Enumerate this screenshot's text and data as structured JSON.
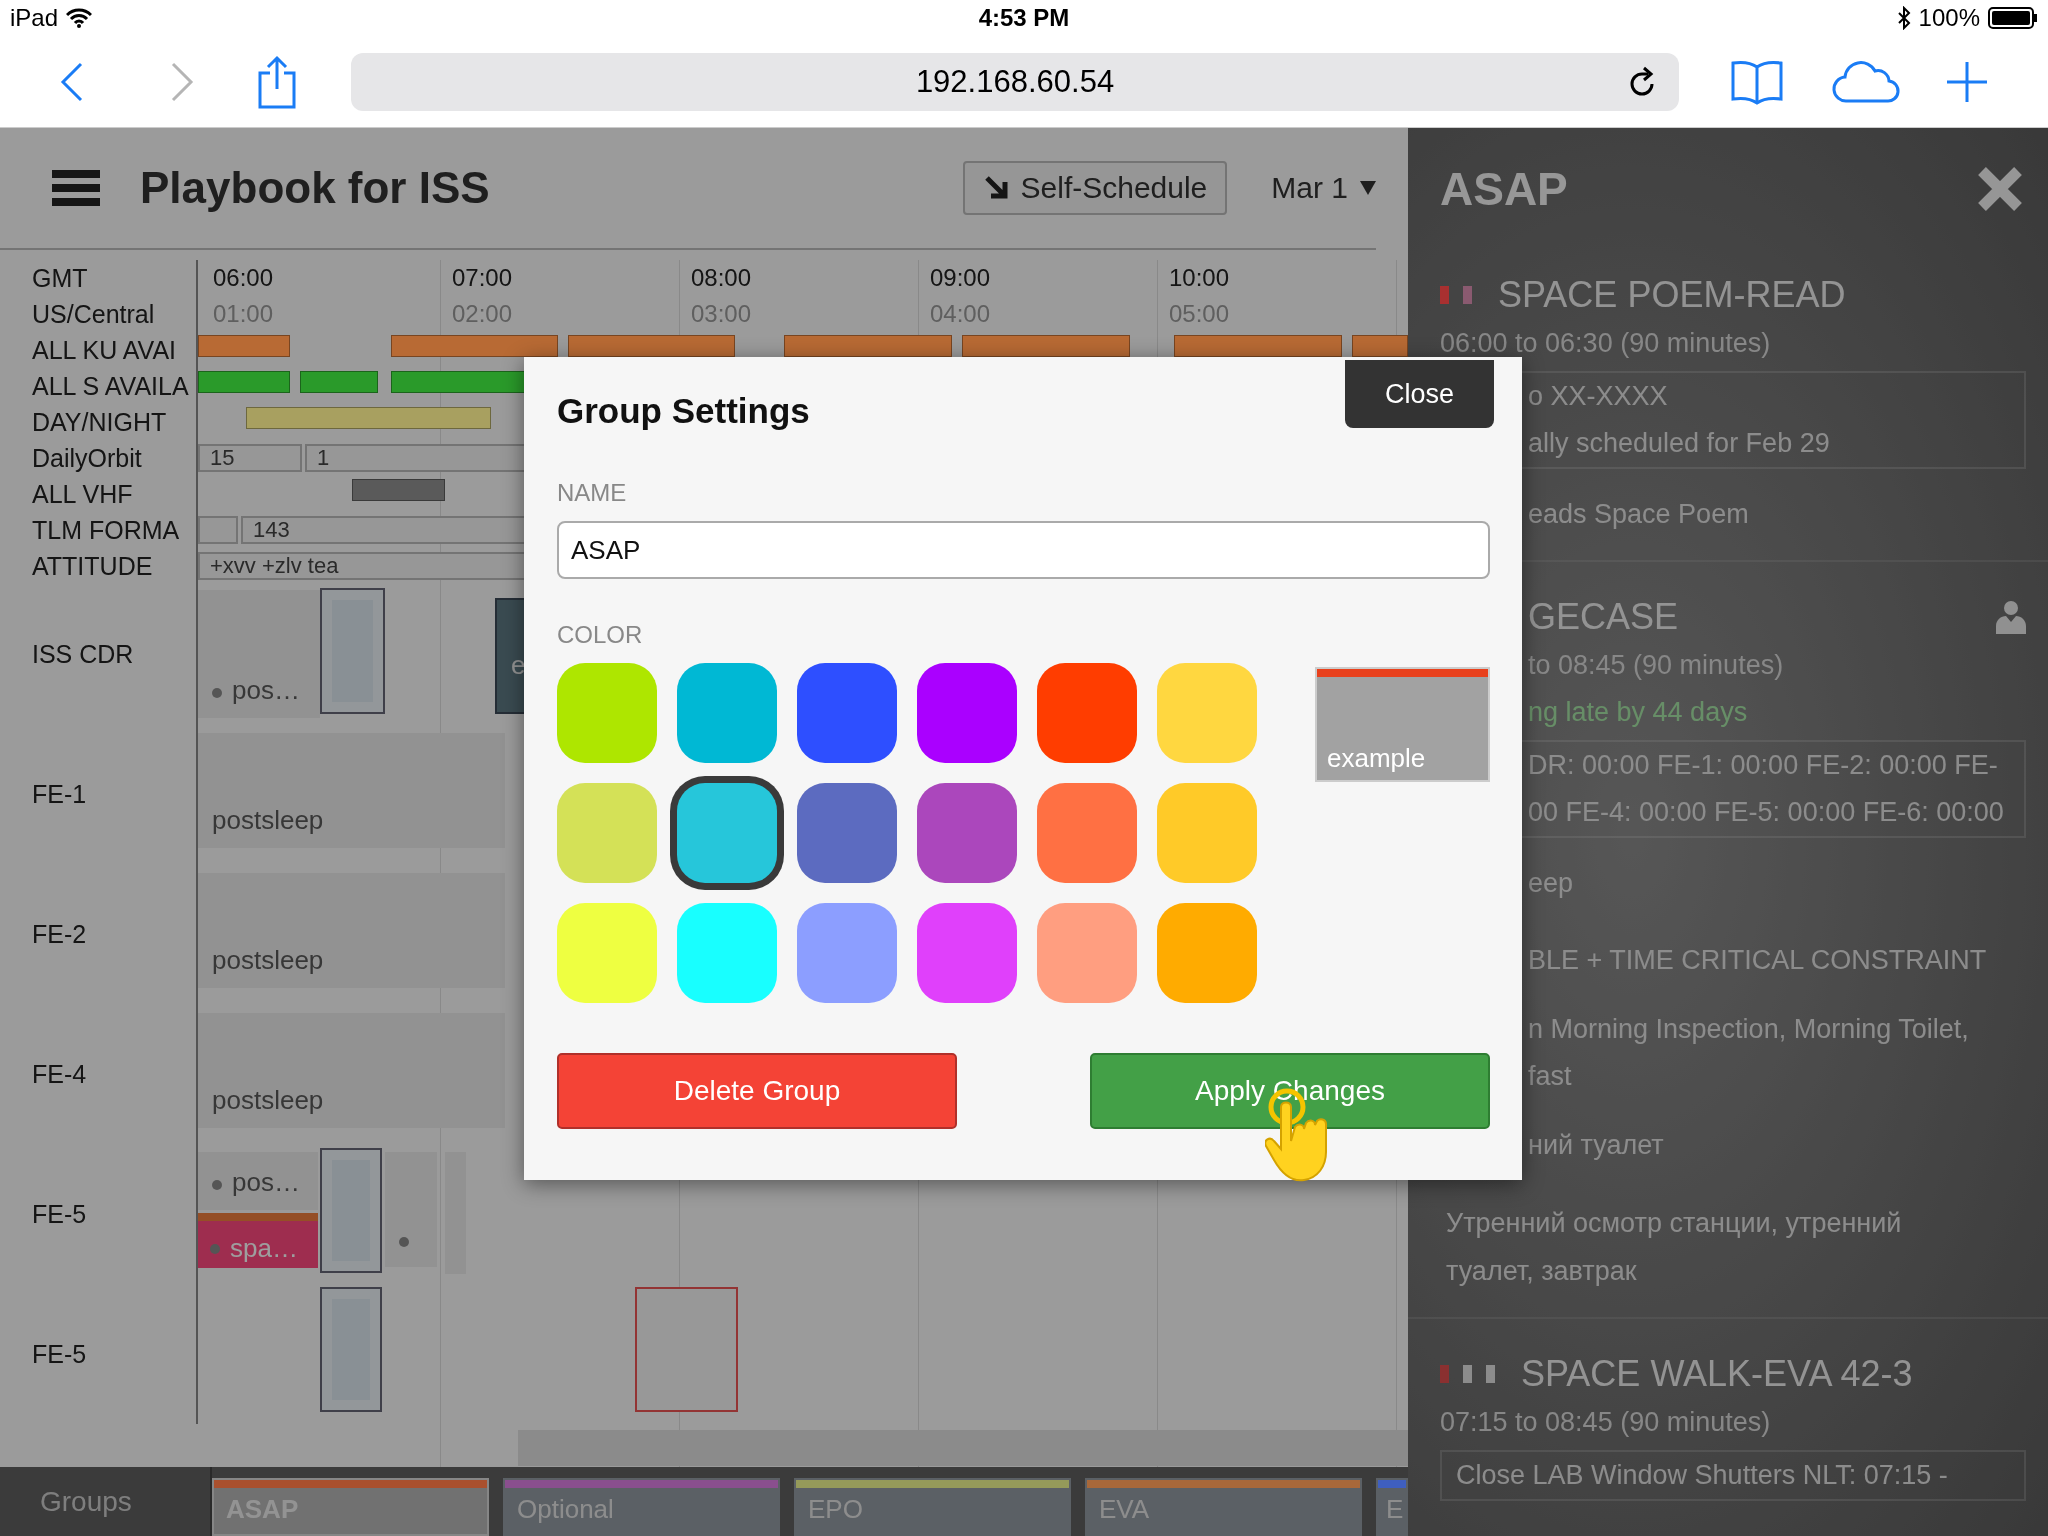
{
  "status_bar": {
    "device": "iPad",
    "time": "4:53 PM",
    "battery": "100%"
  },
  "browser": {
    "back": {
      "disabled": false
    },
    "forward": {
      "disabled": true
    },
    "url": "192.168.60.54"
  },
  "app_header": {
    "title": "Playbook for ISS",
    "self_schedule": "Self-Schedule",
    "date": "Mar 1"
  },
  "timeline": {
    "zones": [
      "GMT",
      "US/Central"
    ],
    "hours": [
      {
        "gmt": "06:00",
        "local": "01:00"
      },
      {
        "gmt": "07:00",
        "local": "02:00"
      },
      {
        "gmt": "08:00",
        "local": "03:00"
      },
      {
        "gmt": "09:00",
        "local": "04:00"
      },
      {
        "gmt": "10:00",
        "local": "05:00"
      }
    ],
    "rows": [
      {
        "label": "ALL KU AVAI",
        "kind": "band",
        "color": "#b86a34"
      },
      {
        "label": "ALL S AVAILA",
        "kind": "band",
        "color": "#2a9a2a"
      },
      {
        "label": "DAY/NIGHT",
        "kind": "band",
        "color": "#a8a060"
      },
      {
        "label": "DailyOrbit",
        "kind": "labels",
        "segments": [
          "15",
          "1"
        ]
      },
      {
        "label": "ALL VHF",
        "kind": "band",
        "color": "#5a5a5a"
      },
      {
        "label": "TLM FORMA",
        "kind": "labels",
        "segments": [
          "143"
        ]
      },
      {
        "label": "ATTITUDE",
        "kind": "labels",
        "segments": [
          "+xvv +zlv tea"
        ]
      },
      {
        "label": "ISS CDR",
        "kind": "crew",
        "activities": [
          "pos…",
          "e"
        ]
      },
      {
        "label": "FE-1",
        "kind": "crew",
        "activities": [
          "postsleep"
        ]
      },
      {
        "label": "FE-2",
        "kind": "crew",
        "activities": [
          "postsleep"
        ]
      },
      {
        "label": "FE-4",
        "kind": "crew",
        "activities": [
          "postsleep"
        ]
      },
      {
        "label": "FE-5",
        "kind": "crew",
        "activities": [
          "pos…",
          "spa…"
        ]
      },
      {
        "label": "FE-5",
        "kind": "crew"
      }
    ]
  },
  "groups": {
    "label": "Groups",
    "tabs": [
      {
        "label": "ASAP",
        "color": "#a9502e",
        "selected": true
      },
      {
        "label": "Optional",
        "color": "#8a4f8e",
        "selected": false
      },
      {
        "label": "EPO",
        "color": "#959a5a",
        "selected": false
      },
      {
        "label": "EVA",
        "color": "#a8683a",
        "selected": false
      },
      {
        "label": "E",
        "color": "#3f5fbf",
        "selected": false
      }
    ]
  },
  "panel": {
    "title": "ASAP",
    "activities": [
      {
        "title": "SPACE POEM-READ",
        "markers": [
          {
            "color": "#a83030"
          },
          {
            "color": "#8a5a70"
          }
        ],
        "lines": [
          {
            "kind": "time",
            "text": "06:00 to 06:30 (90 minutes)"
          },
          {
            "kind": "box",
            "lines": [
              "o XX-XXXX",
              "ally scheduled for Feb 29"
            ]
          },
          {
            "kind": "note",
            "lines": [
              "eads Space Poem"
            ]
          }
        ]
      },
      {
        "title": "GECASE",
        "person_icon": true,
        "lines": [
          {
            "kind": "time",
            "text": "to 08:45 (90 minutes)"
          },
          {
            "kind": "late",
            "text": "ng late by 44 days"
          },
          {
            "kind": "box",
            "lines": [
              "DR: 00:00 FE-1: 00:00 FE-2: 00:00 FE-",
              "00 FE-4: 00:00 FE-5: 00:00 FE-6: 00:00"
            ]
          },
          {
            "kind": "note",
            "lines": [
              "eep"
            ]
          },
          {
            "kind": "constraint",
            "text": "BLE + TIME CRITICAL CONSTRAINT"
          },
          {
            "kind": "lines",
            "lines": [
              "n Morning Inspection, Morning Toilet,",
              "fast"
            ]
          },
          {
            "kind": "note",
            "lines": [
              "ний туалет"
            ]
          },
          {
            "kind": "paragraph",
            "text": "Утренний осмотр станции, утренний туалет, завтрак"
          }
        ]
      },
      {
        "title": "SPACE WALK-EVA 42-3",
        "markers": [
          {
            "color": "#8a3030"
          },
          {
            "color": "#8c8c8c"
          },
          {
            "color": "#8c8c8c"
          }
        ],
        "lines": [
          {
            "kind": "time",
            "text": "07:15 to 08:45 (90 minutes)"
          },
          {
            "kind": "box",
            "lines": [
              "Close LAB Window Shutters NLT: 07:15 -"
            ]
          }
        ]
      }
    ]
  },
  "modal": {
    "title": "Group Settings",
    "close": "Close",
    "name_label": "NAME",
    "name_value": "ASAP",
    "color_label": "COLOR",
    "swatches": [
      {
        "color": "#aee600",
        "selected": false
      },
      {
        "color": "#00b8d4",
        "selected": false
      },
      {
        "color": "#2e4fff",
        "selected": false
      },
      {
        "color": "#aa00ff",
        "selected": false
      },
      {
        "color": "#ff3d00",
        "selected": false
      },
      {
        "color": "#ffd740",
        "selected": false
      },
      {
        "color": "#d4e157",
        "selected": false
      },
      {
        "color": "#26c6da",
        "selected": true
      },
      {
        "color": "#5c6bc0",
        "selected": false
      },
      {
        "color": "#ab47bc",
        "selected": false
      },
      {
        "color": "#ff7043",
        "selected": false
      },
      {
        "color": "#ffca28",
        "selected": false
      },
      {
        "color": "#eeff41",
        "selected": false
      },
      {
        "color": "#18ffff",
        "selected": false
      },
      {
        "color": "#8c9eff",
        "selected": false
      },
      {
        "color": "#e040fb",
        "selected": false
      },
      {
        "color": "#ff9e80",
        "selected": false
      },
      {
        "color": "#ffab00",
        "selected": false
      }
    ],
    "example": {
      "label": "example",
      "color": "#e8401c"
    },
    "delete": "Delete Group",
    "apply": "Apply Changes"
  }
}
